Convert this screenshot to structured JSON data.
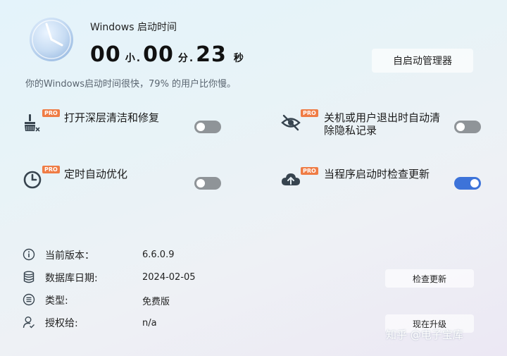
{
  "header": {
    "title": "Windows 启动时间",
    "hours": "00",
    "hours_unit": "小",
    "minutes": "00",
    "minutes_unit": "分",
    "seconds": "23",
    "seconds_unit": "秒",
    "sep": ".",
    "startup_manager_label": "自启动管理器",
    "description": "你的Windows启动时间很快，79% 的用户比你慢。"
  },
  "features": [
    {
      "label": "打开深层清洁和修复",
      "badge": "PRO",
      "icon": "broom-icon",
      "enabled": false
    },
    {
      "label_line1": "关机或用户退出时自动清",
      "label_line2": "除隐私记录",
      "badge": "PRO",
      "icon": "privacy-eye-icon",
      "enabled": false
    },
    {
      "label": "定时自动优化",
      "badge": "PRO",
      "icon": "clock-schedule-icon",
      "enabled": false
    },
    {
      "label": "当程序启动时检查更新",
      "badge": "PRO",
      "icon": "cloud-upload-icon",
      "enabled": true
    }
  ],
  "info": {
    "version_label": "当前版本：",
    "version_value": "6.6.0.9",
    "db_label": "数据库日期:",
    "db_value": "2024-02-05",
    "type_label": "类型:",
    "type_value": "免费版",
    "license_label": "授权给:",
    "license_value": "n/a",
    "check_update_label": "检查更新",
    "upgrade_label": "现在升级"
  },
  "watermark": "知乎 @电子宝库",
  "colors": {
    "accent": "#3d73d9",
    "pro_badge": "#ef7c45",
    "toggle_off": "#8f9498"
  }
}
